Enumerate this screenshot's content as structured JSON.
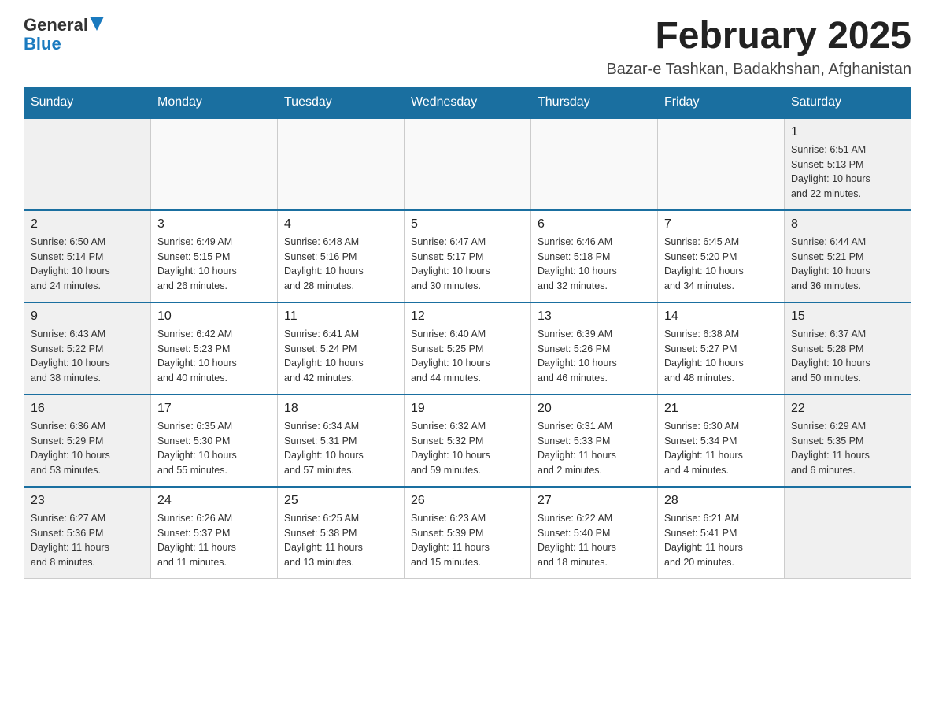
{
  "header": {
    "logo_general": "General",
    "logo_blue": "Blue",
    "title": "February 2025",
    "subtitle": "Bazar-e Tashkan, Badakhshan, Afghanistan"
  },
  "calendar": {
    "days_of_week": [
      "Sunday",
      "Monday",
      "Tuesday",
      "Wednesday",
      "Thursday",
      "Friday",
      "Saturday"
    ],
    "weeks": [
      [
        {
          "day": "",
          "info": ""
        },
        {
          "day": "",
          "info": ""
        },
        {
          "day": "",
          "info": ""
        },
        {
          "day": "",
          "info": ""
        },
        {
          "day": "",
          "info": ""
        },
        {
          "day": "",
          "info": ""
        },
        {
          "day": "1",
          "info": "Sunrise: 6:51 AM\nSunset: 5:13 PM\nDaylight: 10 hours\nand 22 minutes."
        }
      ],
      [
        {
          "day": "2",
          "info": "Sunrise: 6:50 AM\nSunset: 5:14 PM\nDaylight: 10 hours\nand 24 minutes."
        },
        {
          "day": "3",
          "info": "Sunrise: 6:49 AM\nSunset: 5:15 PM\nDaylight: 10 hours\nand 26 minutes."
        },
        {
          "day": "4",
          "info": "Sunrise: 6:48 AM\nSunset: 5:16 PM\nDaylight: 10 hours\nand 28 minutes."
        },
        {
          "day": "5",
          "info": "Sunrise: 6:47 AM\nSunset: 5:17 PM\nDaylight: 10 hours\nand 30 minutes."
        },
        {
          "day": "6",
          "info": "Sunrise: 6:46 AM\nSunset: 5:18 PM\nDaylight: 10 hours\nand 32 minutes."
        },
        {
          "day": "7",
          "info": "Sunrise: 6:45 AM\nSunset: 5:20 PM\nDaylight: 10 hours\nand 34 minutes."
        },
        {
          "day": "8",
          "info": "Sunrise: 6:44 AM\nSunset: 5:21 PM\nDaylight: 10 hours\nand 36 minutes."
        }
      ],
      [
        {
          "day": "9",
          "info": "Sunrise: 6:43 AM\nSunset: 5:22 PM\nDaylight: 10 hours\nand 38 minutes."
        },
        {
          "day": "10",
          "info": "Sunrise: 6:42 AM\nSunset: 5:23 PM\nDaylight: 10 hours\nand 40 minutes."
        },
        {
          "day": "11",
          "info": "Sunrise: 6:41 AM\nSunset: 5:24 PM\nDaylight: 10 hours\nand 42 minutes."
        },
        {
          "day": "12",
          "info": "Sunrise: 6:40 AM\nSunset: 5:25 PM\nDaylight: 10 hours\nand 44 minutes."
        },
        {
          "day": "13",
          "info": "Sunrise: 6:39 AM\nSunset: 5:26 PM\nDaylight: 10 hours\nand 46 minutes."
        },
        {
          "day": "14",
          "info": "Sunrise: 6:38 AM\nSunset: 5:27 PM\nDaylight: 10 hours\nand 48 minutes."
        },
        {
          "day": "15",
          "info": "Sunrise: 6:37 AM\nSunset: 5:28 PM\nDaylight: 10 hours\nand 50 minutes."
        }
      ],
      [
        {
          "day": "16",
          "info": "Sunrise: 6:36 AM\nSunset: 5:29 PM\nDaylight: 10 hours\nand 53 minutes."
        },
        {
          "day": "17",
          "info": "Sunrise: 6:35 AM\nSunset: 5:30 PM\nDaylight: 10 hours\nand 55 minutes."
        },
        {
          "day": "18",
          "info": "Sunrise: 6:34 AM\nSunset: 5:31 PM\nDaylight: 10 hours\nand 57 minutes."
        },
        {
          "day": "19",
          "info": "Sunrise: 6:32 AM\nSunset: 5:32 PM\nDaylight: 10 hours\nand 59 minutes."
        },
        {
          "day": "20",
          "info": "Sunrise: 6:31 AM\nSunset: 5:33 PM\nDaylight: 11 hours\nand 2 minutes."
        },
        {
          "day": "21",
          "info": "Sunrise: 6:30 AM\nSunset: 5:34 PM\nDaylight: 11 hours\nand 4 minutes."
        },
        {
          "day": "22",
          "info": "Sunrise: 6:29 AM\nSunset: 5:35 PM\nDaylight: 11 hours\nand 6 minutes."
        }
      ],
      [
        {
          "day": "23",
          "info": "Sunrise: 6:27 AM\nSunset: 5:36 PM\nDaylight: 11 hours\nand 8 minutes."
        },
        {
          "day": "24",
          "info": "Sunrise: 6:26 AM\nSunset: 5:37 PM\nDaylight: 11 hours\nand 11 minutes."
        },
        {
          "day": "25",
          "info": "Sunrise: 6:25 AM\nSunset: 5:38 PM\nDaylight: 11 hours\nand 13 minutes."
        },
        {
          "day": "26",
          "info": "Sunrise: 6:23 AM\nSunset: 5:39 PM\nDaylight: 11 hours\nand 15 minutes."
        },
        {
          "day": "27",
          "info": "Sunrise: 6:22 AM\nSunset: 5:40 PM\nDaylight: 11 hours\nand 18 minutes."
        },
        {
          "day": "28",
          "info": "Sunrise: 6:21 AM\nSunset: 5:41 PM\nDaylight: 11 hours\nand 20 minutes."
        },
        {
          "day": "",
          "info": ""
        }
      ]
    ]
  }
}
